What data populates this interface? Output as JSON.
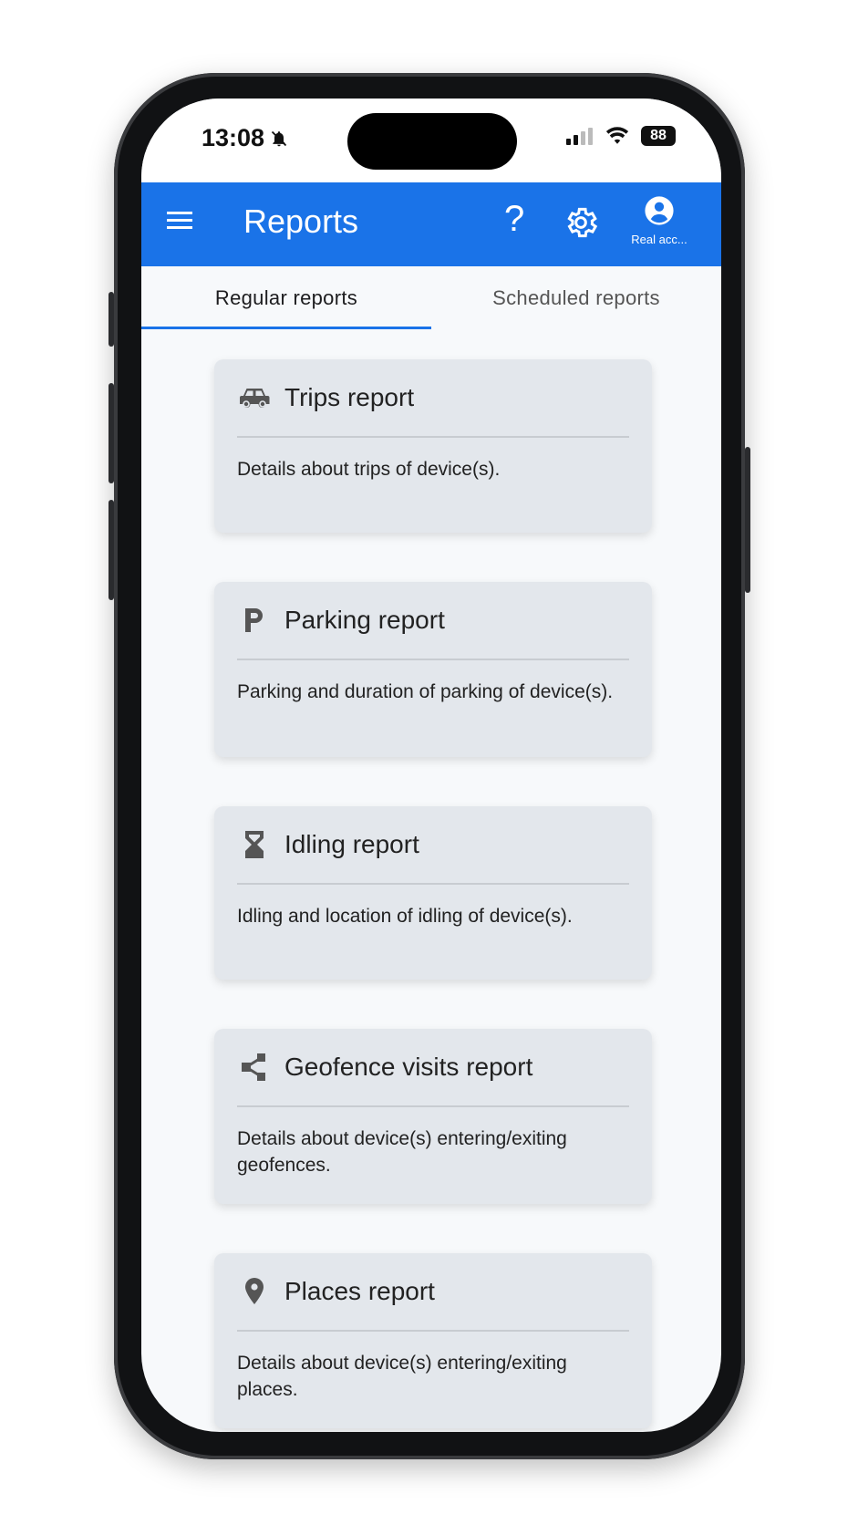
{
  "status_bar": {
    "time": "13:08",
    "battery": "88"
  },
  "app_bar": {
    "title": "Reports",
    "help": "?",
    "account_label": "Real acc..."
  },
  "tabs": [
    {
      "label": "Regular reports",
      "active": true
    },
    {
      "label": "Scheduled reports",
      "active": false
    }
  ],
  "reports": [
    {
      "icon": "car-icon",
      "title": "Trips report",
      "description": "Details about trips of device(s)."
    },
    {
      "icon": "parking-icon",
      "title": "Parking report",
      "description": "Parking and duration of parking of device(s)."
    },
    {
      "icon": "hourglass-icon",
      "title": "Idling report",
      "description": "Idling and location of idling of device(s)."
    },
    {
      "icon": "share-icon",
      "title": "Geofence visits report",
      "description": "Details about device(s) entering/exiting geofences."
    },
    {
      "icon": "place-icon",
      "title": "Places report",
      "description": "Details about device(s) entering/exiting places."
    }
  ],
  "colors": {
    "accent": "#1a73e8",
    "card": "#e3e7ec"
  }
}
